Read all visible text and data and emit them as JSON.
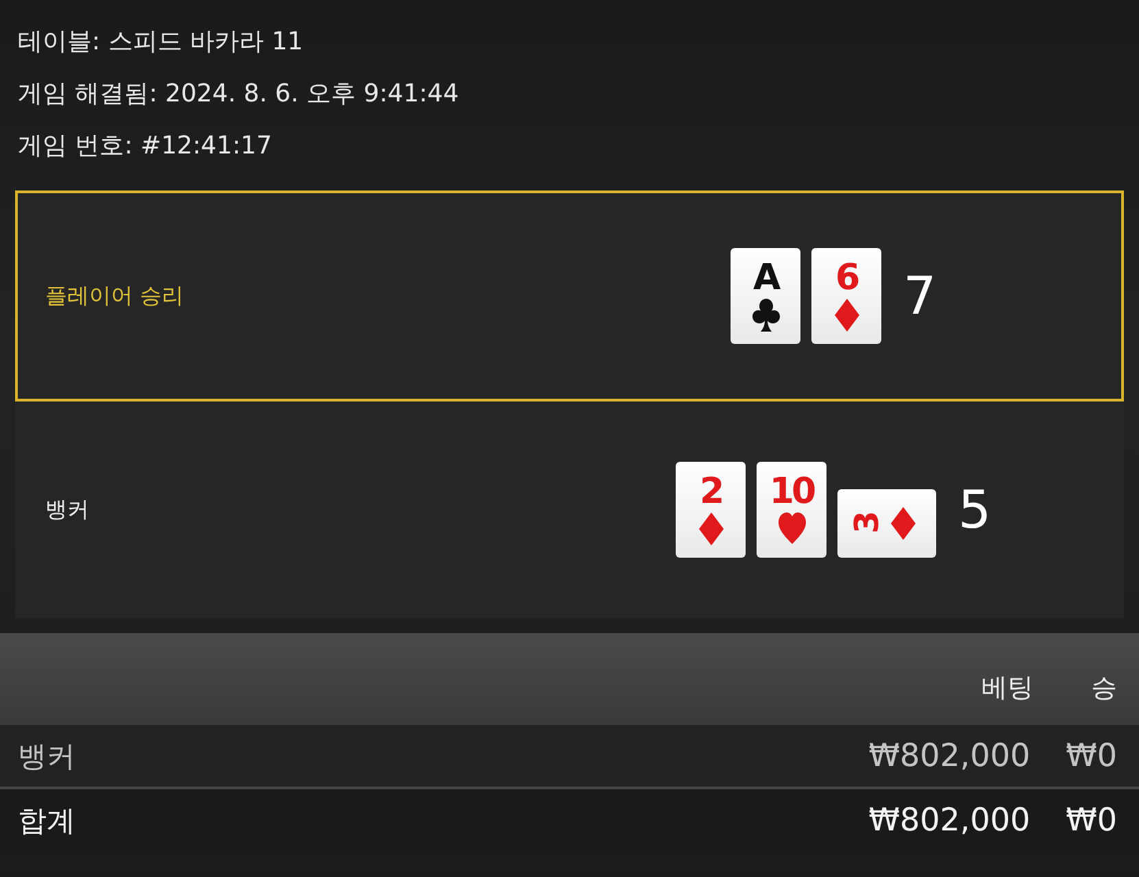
{
  "info": [
    "테이블: 스피드 바카라 11",
    "게임 해결됨: 2024. 8. 6. 오후 9:41:44",
    "게임 번호: #12:41:17"
  ],
  "hands": [
    {
      "label": "플레이어 승리",
      "winner": true,
      "score": "7",
      "cards": [
        {
          "rank": "A",
          "kind": "clubs",
          "sideways": false
        },
        {
          "rank": "6",
          "kind": "diamonds",
          "sideways": false
        }
      ]
    },
    {
      "label": "뱅커",
      "winner": false,
      "score": "5",
      "cards": [
        {
          "rank": "2",
          "kind": "diamonds",
          "sideways": false
        },
        {
          "rank": "10",
          "kind": "hearts",
          "sideways": false
        },
        {
          "rank": "3",
          "kind": "diamonds",
          "sideways": true
        }
      ]
    }
  ],
  "table": {
    "columns": [
      "베팅",
      "승"
    ],
    "rows": [
      {
        "kind": "bet",
        "label": "뱅커",
        "cells": [
          "₩802,000",
          "₩0"
        ]
      },
      {
        "kind": "total",
        "label": "합계",
        "cells": [
          "₩802,000",
          "₩0"
        ]
      }
    ]
  }
}
